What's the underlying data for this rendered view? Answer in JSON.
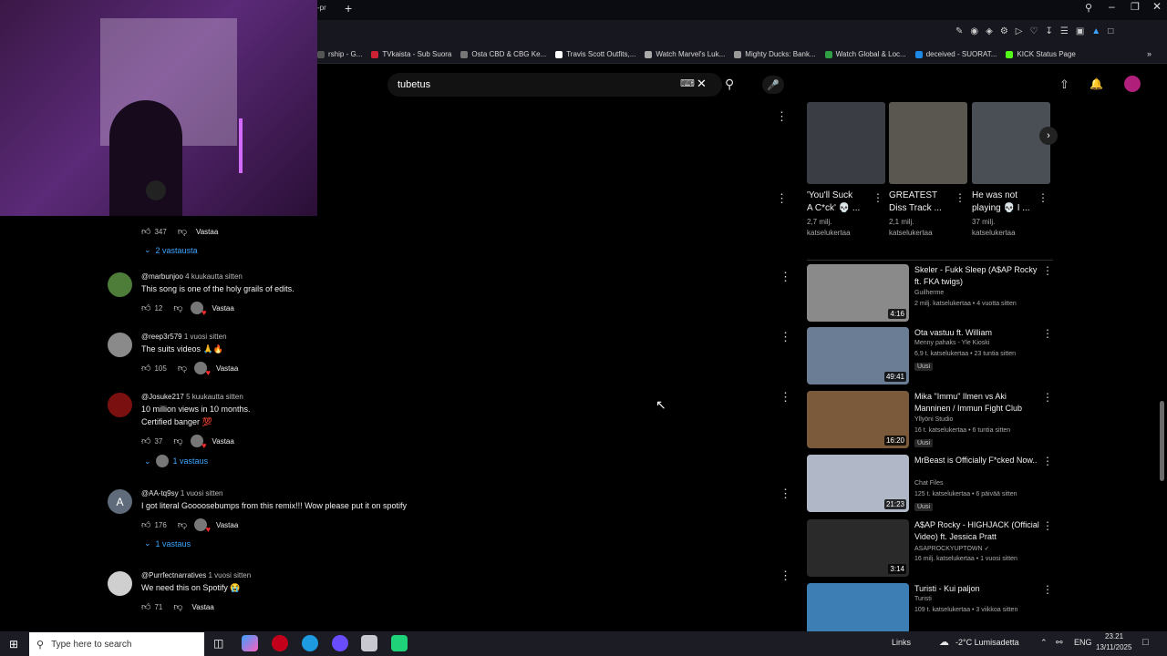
{
  "browser": {
    "tab_title": "-pr",
    "bookmarks": [
      {
        "label": "rship - G...",
        "color": "#555555"
      },
      {
        "label": "TVkaista - Sub Suora",
        "color": "#cc2233"
      },
      {
        "label": "Osta CBD & CBG Ke...",
        "color": "#777777"
      },
      {
        "label": "Travis Scott Outfits,...",
        "color": "#ffffff"
      },
      {
        "label": "Watch Marvel's Luk...",
        "color": "#aaaaaa"
      },
      {
        "label": "Mighty Ducks: Bank...",
        "color": "#999999"
      },
      {
        "label": "Watch Global & Loc...",
        "color": "#2f9e44"
      },
      {
        "label": "deceived - SUORAT...",
        "color": "#1e88e5"
      },
      {
        "label": "KICK Status Page",
        "color": "#53fc18"
      }
    ]
  },
  "search": {
    "value": "tubetus"
  },
  "comments": [
    {
      "likes": "347",
      "reply_label": "Vastaa",
      "replies": "2 vastausta"
    },
    {
      "handle": "@marbunjoo",
      "time": "4 kuukautta sitten",
      "text": [
        "This song is one of the holy grails of edits."
      ],
      "likes": "12",
      "reply_label": "Vastaa",
      "avatar_color": "#4e7d3a"
    },
    {
      "handle": "@reep3r579",
      "time": "1 vuosi sitten",
      "text": [
        "The suits videos 🙏🔥"
      ],
      "likes": "105",
      "reply_label": "Vastaa",
      "avatar_color": "#8a8a8a"
    },
    {
      "handle": "@Josuke217",
      "time": "5 kuukautta sitten",
      "text": [
        "10 million views in 10 months.",
        "Certified banger 💯"
      ],
      "likes": "37",
      "reply_label": "Vastaa",
      "replies": "1 vastaus",
      "avatar_color": "#7a1010"
    },
    {
      "handle": "@AA-tq9sy",
      "time": "1 vuosi sitten",
      "text": [
        "I got literal Goooosebumps from this remix!!! Wow please put it on spotify"
      ],
      "likes": "176",
      "reply_label": "Vastaa",
      "replies": "1 vastaus",
      "avatar_initial": "A",
      "avatar_color": "#5f6b7a"
    },
    {
      "handle": "@Purrfectnarratives",
      "time": "1 vuosi sitten",
      "text": [
        "We need this on Spotify 😭"
      ],
      "likes": "71",
      "reply_label": "Vastaa",
      "avatar_color": "#cfcfcf"
    }
  ],
  "shelf": [
    {
      "title": [
        "'You'll Suck",
        "A C*ck' 💀 ..."
      ],
      "views": "2,7 milj.",
      "views2": "katselukertaa",
      "color": "#3a3e44"
    },
    {
      "title": [
        "GREATEST",
        "Diss Track ..."
      ],
      "views": "2,1 milj.",
      "views2": "katselukertaa",
      "color": "#5a5650"
    },
    {
      "title": [
        "He was not",
        "playing 💀 I ..."
      ],
      "views": "37 milj.",
      "views2": "katselukertaa",
      "color": "#4a4e55"
    }
  ],
  "videos": [
    {
      "title": "Skeler - Fukk Sleep (A$AP Rocky ft. FKA twigs)",
      "channel": "Guilherme",
      "meta": "2 milj. katselukertaa • 4 vuotta sitten",
      "duration": "4:16",
      "color": "#8a8a8a"
    },
    {
      "title": "Ota vastuu ft. William",
      "channel": "Menny pahaks - Yle Kioski",
      "meta": "6,9 t. katselukertaa • 23 tuntia sitten",
      "badge": "Uusi",
      "duration": "49:41",
      "color": "#6b7c95"
    },
    {
      "title": "Mika \"Immu\" Ilmen vs Aki Manninen / Immun Fight Club",
      "channel": "Yllyöni Studio",
      "meta": "16 t. katselukertaa • 6 tuntia sitten",
      "badge": "Uusi",
      "duration": "16:20",
      "color": "#7a5a3a"
    },
    {
      "title": "MrBeast is Officially F*cked Now..",
      "channel": "Chat Files",
      "meta": "125 t. katselukertaa • 6 päivää sitten",
      "badge": "Uusi",
      "duration": "21:23",
      "color": "#b0b8c8"
    },
    {
      "title": "A$AP Rocky - HIGHJACK (Official Video) ft. Jessica Pratt",
      "channel": "ASAPROCKYUPTOWN ✓",
      "meta": "16 milj. katselukertaa • 1 vuosi sitten",
      "duration": "3:14",
      "color": "#2a2a2a"
    },
    {
      "title": "Turisti - Kui paljon",
      "channel": "Turisti",
      "meta": "109 t. katselukertaa • 3 viikkoa sitten",
      "color": "#3d7fb5"
    }
  ],
  "taskbar": {
    "search_placeholder": "Type here to search",
    "links": "Links",
    "weather": "-2°C  Lumisadetta",
    "lang": "ENG",
    "time": "23.21",
    "date": "13/11/2025"
  }
}
